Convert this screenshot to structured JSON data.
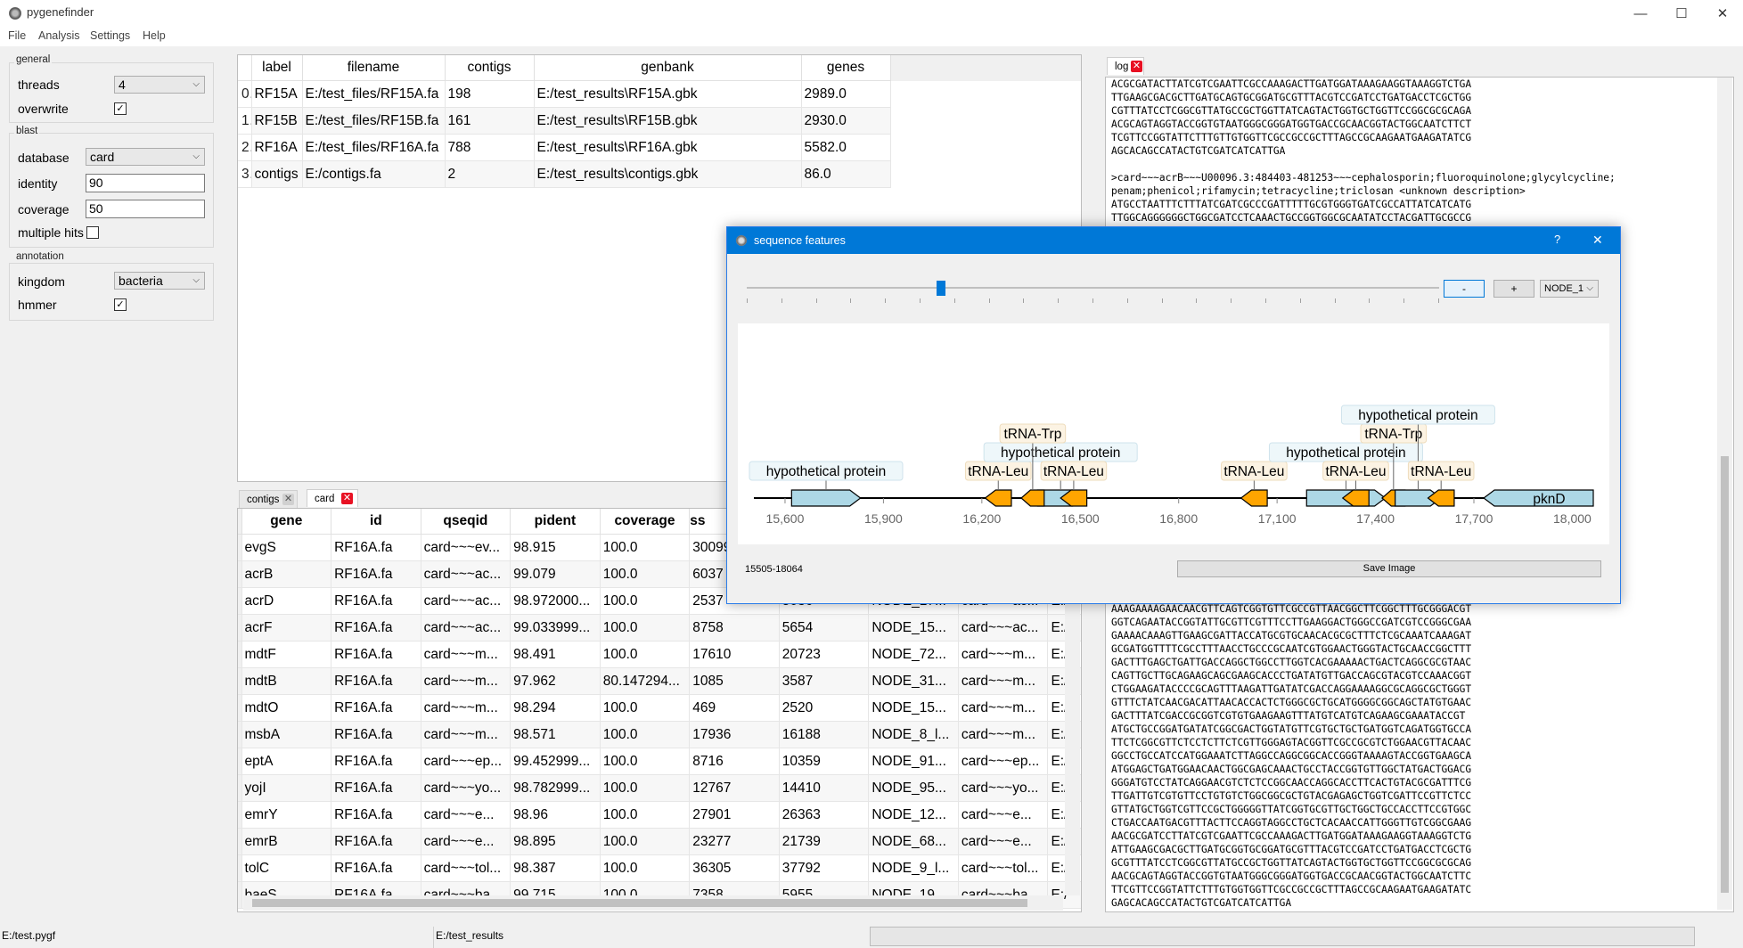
{
  "window": {
    "title": "pygenefinder",
    "minimize": "—",
    "maximize": "☐",
    "close": "✕"
  },
  "menu": [
    "File",
    "Analysis",
    "Settings",
    "Help"
  ],
  "general": {
    "title": "general",
    "threads_label": "threads",
    "threads_value": "4",
    "overwrite_label": "overwrite",
    "overwrite_checked": "✓"
  },
  "blast": {
    "title": "blast",
    "database_label": "database",
    "database_value": "card",
    "identity_label": "identity",
    "identity_value": "90",
    "coverage_label": "coverage",
    "coverage_value": "50",
    "multiple_hits_label": "multiple hits"
  },
  "annotation": {
    "title": "annotation",
    "kingdom_label": "kingdom",
    "kingdom_value": "bacteria",
    "hmmer_label": "hmmer",
    "hmmer_checked": "✓"
  },
  "files_table": {
    "headers": [
      "label",
      "filename",
      "contigs",
      "genbank",
      "genes"
    ],
    "rows": [
      {
        "idx": "0",
        "label": "RF15A",
        "filename": "E:/test_files/RF15A.fa",
        "contigs": "198",
        "genbank": "E:/test_results\\RF15A.gbk",
        "genes": "2989.0"
      },
      {
        "idx": "1",
        "label": "RF15B",
        "filename": "E:/test_files/RF15B.fa",
        "contigs": "161",
        "genbank": "E:/test_results\\RF15B.gbk",
        "genes": "2930.0"
      },
      {
        "idx": "2",
        "label": "RF16A",
        "filename": "E:/test_files/RF16A.fa",
        "contigs": "788",
        "genbank": "E:/test_results\\RF16A.gbk",
        "genes": "5582.0"
      },
      {
        "idx": "3",
        "label": "contigs",
        "filename": "E:/contigs.fa",
        "contigs": "2",
        "genbank": "E:/test_results\\contigs.gbk",
        "genes": "86.0"
      }
    ]
  },
  "tabs": {
    "contigs": "contigs",
    "card": "card",
    "close": "✕"
  },
  "card_table": {
    "headers": [
      "gene",
      "id",
      "qseqid",
      "pident",
      "coverage",
      "ss",
      "",
      "",
      "",
      ""
    ],
    "rows": [
      [
        "evgS",
        "RF16A.fa",
        "card~~~ev...",
        "98.915",
        "100.0",
        "30099",
        "",
        "",
        "",
        ""
      ],
      [
        "acrB",
        "RF16A.fa",
        "card~~~ac...",
        "99.079",
        "100.0",
        "6037",
        "",
        "",
        "",
        ""
      ],
      [
        "acrD",
        "RF16A.fa",
        "card~~~ac...",
        "98.972000...",
        "100.0",
        "2537",
        "5036",
        "NODE_17...",
        "card~~~ac...",
        "E:/"
      ],
      [
        "acrF",
        "RF16A.fa",
        "card~~~ac...",
        "99.033999...",
        "100.0",
        "8758",
        "5654",
        "NODE_15...",
        "card~~~ac...",
        "E:/"
      ],
      [
        "mdtF",
        "RF16A.fa",
        "card~~~m...",
        "98.491",
        "100.0",
        "17610",
        "20723",
        "NODE_72...",
        "card~~~m...",
        "E:/"
      ],
      [
        "mdtB",
        "RF16A.fa",
        "card~~~m...",
        "97.962",
        "80.147294...",
        "1085",
        "3587",
        "NODE_31...",
        "card~~~m...",
        "E:/"
      ],
      [
        "mdtO",
        "RF16A.fa",
        "card~~~m...",
        "98.294",
        "100.0",
        "469",
        "2520",
        "NODE_15...",
        "card~~~m...",
        "E:/"
      ],
      [
        "msbA",
        "RF16A.fa",
        "card~~~m...",
        "98.571",
        "100.0",
        "17936",
        "16188",
        "NODE_8_l...",
        "card~~~m...",
        "E:/"
      ],
      [
        "eptA",
        "RF16A.fa",
        "card~~~ep...",
        "99.452999...",
        "100.0",
        "8716",
        "10359",
        "NODE_91...",
        "card~~~ep...",
        "E:/"
      ],
      [
        "yojI",
        "RF16A.fa",
        "card~~~yo...",
        "98.782999...",
        "100.0",
        "12767",
        "14410",
        "NODE_95...",
        "card~~~yo...",
        "E:/"
      ],
      [
        "emrY",
        "RF16A.fa",
        "card~~~e...",
        "98.96",
        "100.0",
        "27901",
        "26363",
        "NODE_12...",
        "card~~~e...",
        "E:/"
      ],
      [
        "emrB",
        "RF16A.fa",
        "card~~~e...",
        "98.895",
        "100.0",
        "23277",
        "21739",
        "NODE_68...",
        "card~~~e...",
        "E:/"
      ],
      [
        "tolC",
        "RF16A.fa",
        "card~~~tol...",
        "98.387",
        "100.0",
        "36305",
        "37792",
        "NODE_9_l...",
        "card~~~tol...",
        "E:/"
      ],
      [
        "baeS",
        "RF16A.fa",
        "card~~~ba...",
        "99.715",
        "100.0",
        "7358",
        "5955",
        "NODE_19...",
        "card~~~ba...",
        "E:/"
      ]
    ]
  },
  "log": {
    "tab": "log",
    "top_lines": [
      "ACGCGATACTTATCGTCGAATTCGCCAAAGACTTGATGGATAAAGAAGGTAAAGGTCTGA",
      "TTGAAGCGACGCTTGATGCAGTGCGGATGCGTTTACGTCCGATCCTGATGACCTCGCTGG",
      "CGTTTATCCTCGGCGTTATGCCGCTGGTTATCAGTACTGGTGCTGGTTCCGGCGCGCAGA",
      "ACGCAGTAGGTACCGGTGTAATGGGCGGGATGGTGACCGCAACGGTACTGGCAATCTTCT",
      "TCGTTCCGGTATTCTTTGTTGTGGTTCGCCGCCGCTTTAGCCGCAAGAATGAAGATATCG",
      "AGCACAGCCATACTGTCGATCATCATTGA",
      "",
      ">card~~~acrB~~~U00096.3:484403-481253~~~cephalosporin;fluoroquinolone;glycylcycline;",
      "penam;phenicol;rifamycin;tetracycline;triclosan <unknown description>",
      "ATGCCTAATTTCTTTATCGATCGCCCGATTTTTGCGTGGGTGATCGCCATTATCATCATG",
      "TTGGCAGGGGGGCTGGCGATCCTCAAACTGCCGGTGGCGCAATATCCTACGATTGCGCCG"
    ],
    "bottom_lines": [
      "AAAGAAAAGAACAACGTTCAGTCGGTGTTCGCCGTTAACGGCTTCGGCTTTGCGGGACGT",
      "GGTCAGAATACCGGTATTGCGTTCGTTTCCTTGAAGGACTGGGCCGATCGTCCGGGCGAA",
      "GAAAACAAAGTTGAAGCGATTACCATGCGTGCAACACGCGCTTTCTCGCAAATCAAAGAT",
      "GCGATGGTTTTCGCCTTTAACCTGCCCGCAATCGTGGAACTGGGTACTGCAACCGGCTTT",
      "GACTTTGAGCTGATTGACCAGGCTGGCCTTGGTCACGAAAAACTGACTCAGGCGCGTAAC",
      "CAGTTGCTTGCAGAAGCAGCGAAGCACCCTGATATGTTGACCAGCGTACGTCCAAACGGT",
      "CTGGAAGATACCCCGCAGTTTAAGATTGATATCGACCAGGAAAAGGCGCAGGCGCTGGGT",
      "GTTTCTATCAACGACATTAACACCACTCTGGGCGCTGCATGGGGCGGCAGCTATGTGAAC",
      "GACTTTATCGACCGCGGTCGTGTGAAGAAGTTTATGTCATGTCAGAAGCGAAATACCGT",
      "ATGCTGCCGGATGATATCGGCGACTGGTATGTTCGTGCTGCTGATGGTCAGATGGTGCCA",
      "TTCTCGGCGTTCTCCTCTTCTCGTTGGGAGTACGGTTCGCCGCGTCTGGAACGTTACAAC",
      "GGCCTGCCATCCATGGAAATCTTAGGCCAGGCGGCACCGGGTAAAAGTACCGGTGAAGCA",
      "ATGGAGCTGATGGAACAACTGGCGAGCAAACTGCCTACCGGTGTTGGCTATGACTGGACG",
      "GGGATGTCCTATCAGGAACGTCTCTCCGGCAACCAGGCACCTTCACTGTACGCGATTTCG",
      "TTGATTGTCGTGTTCCTGTGTCTGGCGGCGCTGTACGAGAGCTGGTCGATTCCGTTCTCC",
      "GTTATGCTGGTCGTTCCGCTGGGGGTTATCGGTGCGTTGCTGGCTGCCACCTTCCGTGGC",
      "CTGACCAATGACGTTTACTTCCAGGTAGGCCTGCTCACAACCATTGGGTTGTCGGCGAAG",
      "AACGCGATCCTTATCGTCGAATTCGCCAAAGACTTGATGGATAAAGAAGGTAAAGGTCTG",
      "ATTGAAGCGACGCTTGATGCGGTGCGGATGCGTTTACGTCCGATCCTGATGACCTCGCTG",
      "GCGTTTATCCTCGGCGTTATGCCGCTGGTTATCAGTACTGGTGCTGGTTCCGGCGCGCAG",
      "AACGCAGTAGGTACCGGTGTAATGGGCGGGATGGTGACCGCAACGGTACTGGCAATCTTC",
      "TTCGTTCCGGTATTCTTTGTGGTGGTTCGCCGCCGCTTTAGCCGCAAGAATGAAGATATC",
      "GAGCACAGCCATACTGTCGATCATCATTGA"
    ]
  },
  "dialog": {
    "title": "sequence features",
    "help": "?",
    "close": "✕",
    "minus": "-",
    "plus": "+",
    "node": "NODE_1",
    "range": "15505-18064",
    "save": "Save Image",
    "slider_value": 0.28,
    "axis": {
      "min": 15505,
      "max": 18064,
      "ticks": [
        "15,600",
        "15,900",
        "16,200",
        "16,500",
        "16,800",
        "17,100",
        "17,400",
        "17,700",
        "18,000"
      ]
    },
    "features": [
      {
        "name": "hypothetical protein",
        "type": "CDS",
        "start": 15620,
        "end": 15830,
        "strand": 1
      },
      {
        "name": "tRNA-Leu",
        "type": "tRNA",
        "start": 16210,
        "end": 16290,
        "strand": -1
      },
      {
        "name": "hypothetical protein",
        "type": "CDS",
        "start": 16370,
        "end": 16510,
        "strand": 1
      },
      {
        "name": "tRNA-Trp",
        "type": "tRNA",
        "start": 16320,
        "end": 16390,
        "strand": -1
      },
      {
        "name": "tRNA-Leu",
        "type": "tRNA",
        "start": 16440,
        "end": 16520,
        "strand": -1
      },
      {
        "name": "tRNA-Leu",
        "type": "tRNA",
        "start": 16990,
        "end": 17070,
        "strand": -1
      },
      {
        "name": "hypothetical protein",
        "type": "CDS",
        "start": 17190,
        "end": 17430,
        "strand": 1
      },
      {
        "name": "tRNA-Leu",
        "type": "tRNA",
        "start": 17300,
        "end": 17380,
        "strand": -1
      },
      {
        "name": "tRNA-Trp",
        "type": "tRNA",
        "start": 17420,
        "end": 17490,
        "strand": -1
      },
      {
        "name": "hypothetical protein",
        "type": "CDS",
        "start": 17460,
        "end": 17600,
        "strand": 1
      },
      {
        "name": "tRNA-Leu",
        "type": "tRNA",
        "start": 17560,
        "end": 17640,
        "strand": -1
      },
      {
        "name": "pknD",
        "type": "CDS",
        "start": 17730,
        "end": 18064,
        "strand": -1
      }
    ]
  },
  "status": {
    "project": "E:/test.pygf",
    "results": "E:/test_results"
  },
  "colors": {
    "cds": "#add8e6",
    "trna": "#ffa500",
    "titlebar": "#0078d7"
  }
}
